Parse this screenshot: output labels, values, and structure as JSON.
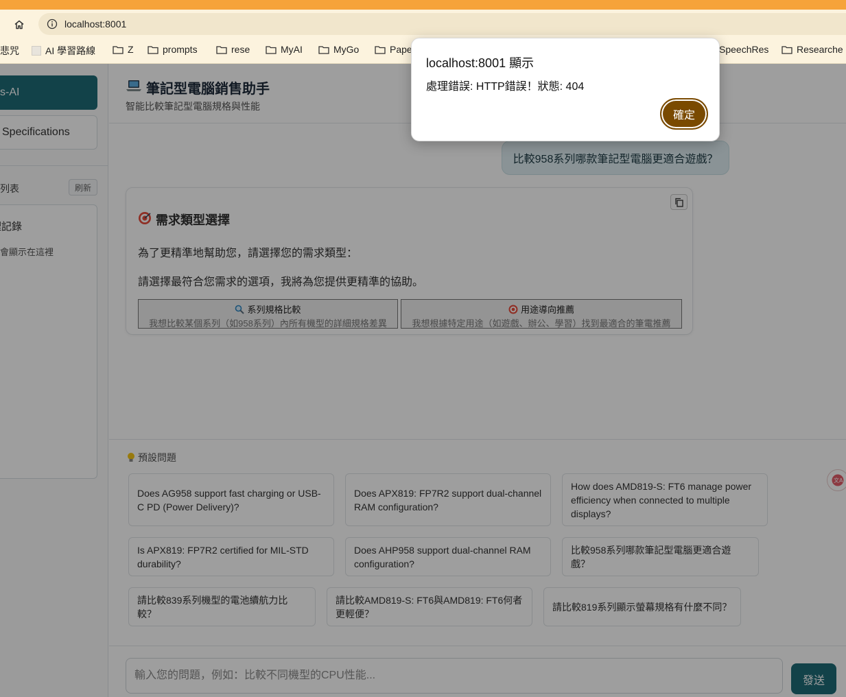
{
  "browser": {
    "url": "localhost:8001",
    "bookmarks": [
      {
        "label": "悲咒",
        "icon": "none"
      },
      {
        "label": "AI 學習路線",
        "icon": "page-favicon"
      },
      {
        "label": "Z",
        "icon": "folder-icon"
      },
      {
        "label": "prompts",
        "icon": "folder-icon"
      },
      {
        "label": "rese",
        "icon": "folder-icon"
      },
      {
        "label": "MyAI",
        "icon": "folder-icon"
      },
      {
        "label": "MyGo",
        "icon": "folder-icon"
      },
      {
        "label": "Pape",
        "icon": "folder-icon"
      },
      {
        "label": "SpeechRes",
        "icon": "none"
      },
      {
        "label": "Researche",
        "icon": "folder-icon"
      }
    ]
  },
  "sidebar": {
    "brand_label": "s-AI",
    "spec_label": "Specifications",
    "list_title": "案列表",
    "refresh_label": "刷新",
    "records_title": "理記錄",
    "records_empty": "料會顯示在這裡"
  },
  "header": {
    "title": "筆記型電腦銷售助手",
    "subtitle": "智能比較筆記型電腦規格與性能"
  },
  "chat": {
    "user_message": "比較958系列哪款筆記型電腦更適合遊戲？",
    "bot": {
      "title": "需求類型選擇",
      "line1": "為了更精準地幫助您，請選擇您的需求類型：",
      "line2": "請選擇最符合您需求的選項，我將為您提供更精準的協助。",
      "options": [
        {
          "label": "系列規格比較",
          "desc": "我想比較某個系列（如958系列）內所有機型的詳細規格差異",
          "icon": "magnifier-icon"
        },
        {
          "label": "用途導向推薦",
          "desc": "我想根據特定用途（如遊戲、辦公、學習）找到最適合的筆電推薦",
          "icon": "target-icon"
        }
      ]
    }
  },
  "presets": {
    "title": "預設問題",
    "questions": [
      "Does AG958 support fast charging or USB-C PD (Power Delivery)?",
      "Does APX819: FP7R2 support dual-channel RAM configuration?",
      "How does AMD819-S: FT6 manage power efficiency when connected to multiple displays?",
      "Is APX819: FP7R2 certified for MIL-STD durability?",
      "Does AHP958 support dual-channel RAM configuration?",
      "比較958系列哪款筆記型電腦更適合遊戲？",
      "請比較839系列機型的電池續航力比較？",
      "請比較AMD819-S: FT6與AMD819: FT6何者更輕便？",
      "請比較819系列顯示螢幕規格有什麼不同？"
    ]
  },
  "input": {
    "placeholder": "輸入您的問題，例如：比較不同機型的CPU性能...",
    "send_label": "發送"
  },
  "dialog": {
    "title": "localhost:8001 顯示",
    "message": "處理錯誤: HTTP錯誤！狀態: 404",
    "ok_label": "確定"
  },
  "colors": {
    "accent": "#1d6b76",
    "chrome_top": "#f6a33a",
    "chrome_bar": "#fcf3de",
    "dialog_button": "#7a4a00"
  }
}
